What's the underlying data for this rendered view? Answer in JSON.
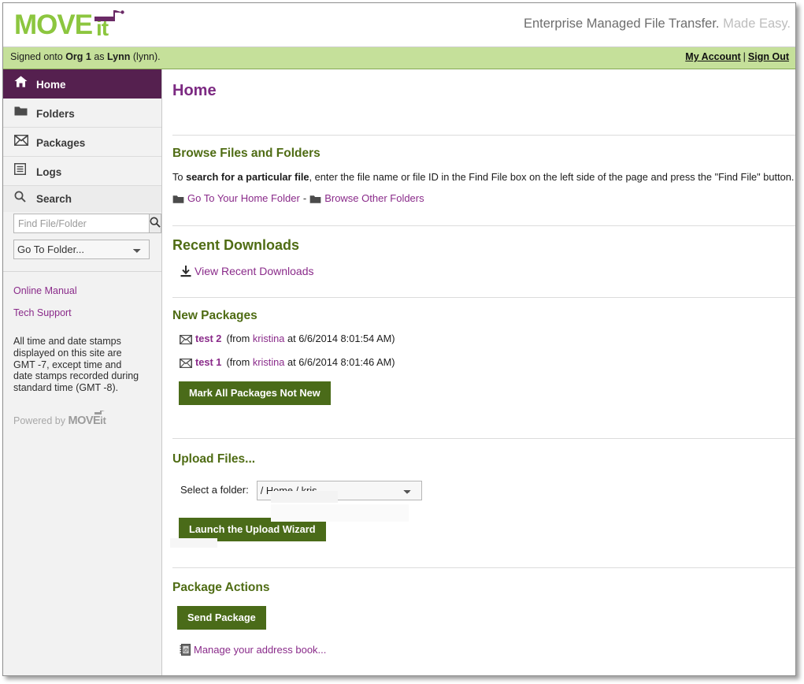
{
  "brand": {
    "logo_move": "MOVE",
    "logo_it": "it",
    "tagline_strong": "Enterprise Managed File Transfer.",
    "tagline_light": " Made Easy.",
    "green": "#8CC63F",
    "purple": "#55204f",
    "olive": "#4f6c14"
  },
  "signbar": {
    "signed_prefix": "Signed onto ",
    "org": "Org 1",
    "signed_mid": " as ",
    "user_name": "Lynn",
    "signed_suffix": " (lynn).",
    "my_account": "My Account",
    "separator": "|",
    "sign_out": "Sign Out"
  },
  "sidebar": {
    "items": [
      {
        "label": "Home",
        "icon": "home-icon",
        "active": true
      },
      {
        "label": "Folders",
        "icon": "folder-icon",
        "active": false
      },
      {
        "label": "Packages",
        "icon": "envelope-icon",
        "active": false
      },
      {
        "label": "Logs",
        "icon": "list-icon",
        "active": false
      }
    ],
    "search_heading": "Search",
    "search_placeholder": "Find File/Folder",
    "search_value": "",
    "goto_folder_selected": "Go To Folder...",
    "online_manual": "Online Manual",
    "tech_support": "Tech Support",
    "timezone_note": "All time and date stamps displayed on this site are GMT -7, except time and date stamps recorded during standard time (GMT -8).",
    "powered_by": "Powered by ",
    "powered_move": "MOVE",
    "powered_it": "it"
  },
  "main": {
    "page_title": "Home",
    "browse": {
      "heading": "Browse Files and Folders",
      "para_lead": "To ",
      "para_bold": "search for a particular file",
      "para_rest": ", enter the file name or file ID in the Find File box on the left side of the page and press the \"Find File\" button.",
      "home_folder_link": "Go To Your Home Folder",
      "dash": "-",
      "other_folders_link": "Browse Other Folders"
    },
    "recent_downloads": {
      "heading": "Recent Downloads",
      "view_link": "View Recent Downloads"
    },
    "new_packages": {
      "heading": "New Packages",
      "items": [
        {
          "name": "test 2",
          "from_prefix": "(from ",
          "sender": "kristina",
          "meta": " at 6/6/2014 8:01:54 AM)"
        },
        {
          "name": "test 1",
          "from_prefix": "(from ",
          "sender": "kristina",
          "meta": " at 6/6/2014 8:01:46 AM)"
        }
      ],
      "mark_button": "Mark All Packages Not New"
    },
    "upload": {
      "heading": "Upload Files...",
      "select_label": "Select a folder:",
      "folder_selected": "/ Home / kris",
      "launch_button": "Launch the Upload Wizard"
    },
    "package_actions": {
      "heading": "Package Actions",
      "send_button": "Send Package",
      "address_book_link": "Manage your address book..."
    }
  }
}
